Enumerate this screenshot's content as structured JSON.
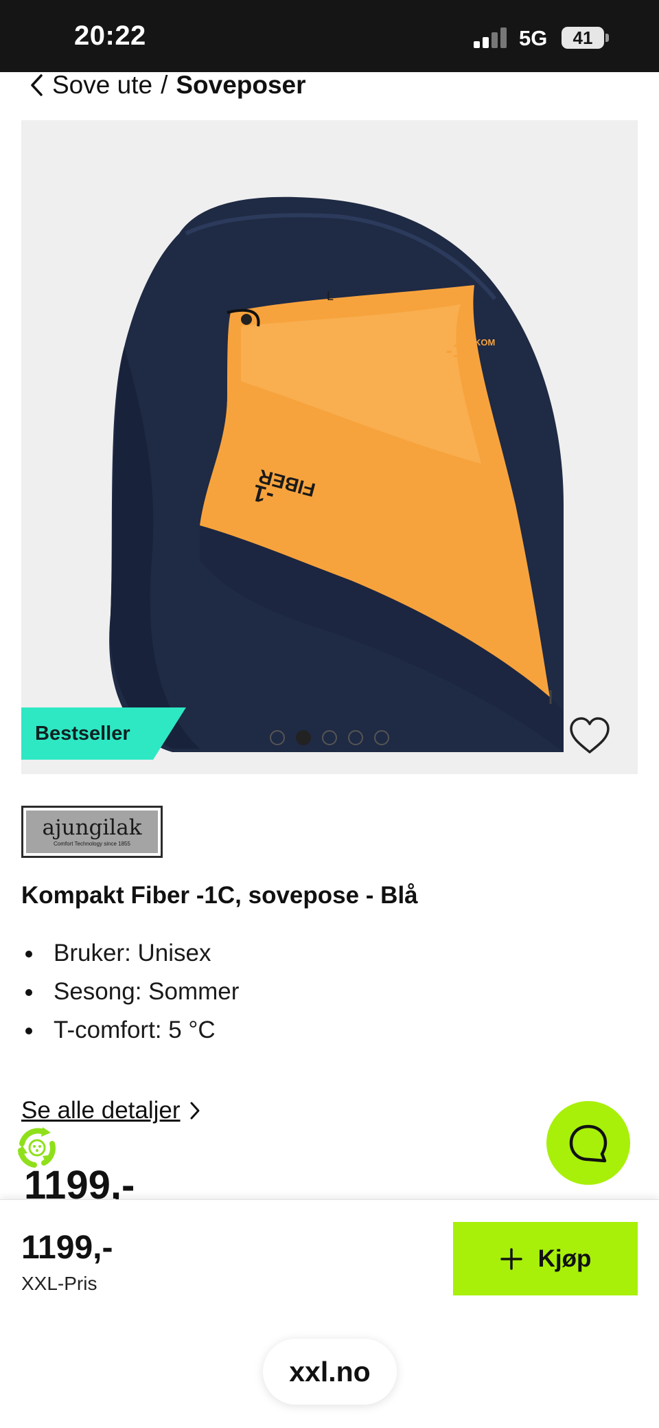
{
  "status_bar": {
    "time": "20:22",
    "network": "5G",
    "battery": "41"
  },
  "breadcrumb": {
    "parent": "Sove ute",
    "separator": "/",
    "current": "Soveposer"
  },
  "product_image": {
    "badge": "Bestseller",
    "carousel": {
      "total": 5,
      "active_index": 1
    },
    "colors": {
      "shell": "#1f2a44",
      "lining": "#f7a33d",
      "background": "#efefef"
    }
  },
  "brand": {
    "name": "ajungilak",
    "tagline": "Comfort Technology since 1855"
  },
  "product": {
    "title": "Kompakt Fiber -1C, sovepose - Blå",
    "specs": [
      "Bruker: Unisex",
      "Sesong: Sommer",
      "T-comfort: 5 °C"
    ],
    "details_link": "Se alle detaljer",
    "partial_price": "1199,-"
  },
  "purchase_bar": {
    "price": "1199,-",
    "price_label": "XXL-Pris",
    "buy_label": "Kjøp",
    "accent_color": "#a8f00a"
  },
  "browser": {
    "url": "xxl.no"
  },
  "icons": [
    "chevron-left-icon",
    "heart-icon",
    "chevron-right-icon",
    "eco-recycle-icon",
    "chat-icon",
    "plus-icon"
  ]
}
